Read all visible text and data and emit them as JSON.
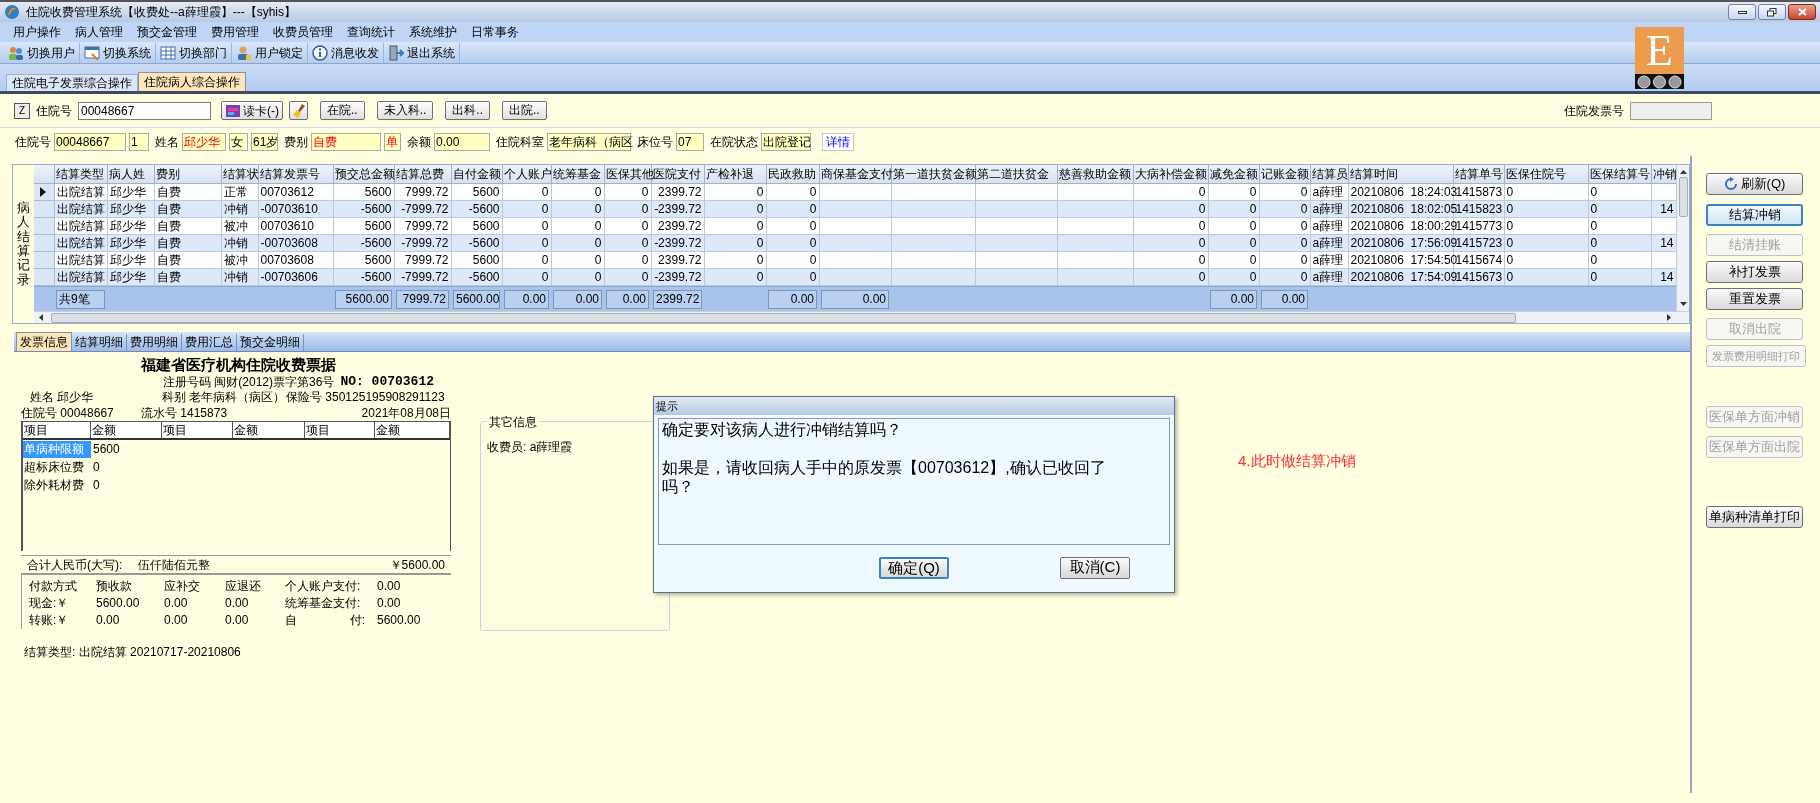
{
  "window": {
    "title": "住院收费管理系统【收费处--a薛理霞】---【syhis】"
  },
  "logo": {
    "letter": "E"
  },
  "menu": [
    "用户操作",
    "病人管理",
    "预交金管理",
    "费用管理",
    "收费员管理",
    "查询统计",
    "系统维护",
    "日常事务"
  ],
  "toolbar": [
    "切换用户",
    "切换系统",
    "切换部门",
    "用户锁定",
    "消息收发",
    "退出系统"
  ],
  "tabs": [
    {
      "label": "住院电子发票综合操作",
      "selected": false
    },
    {
      "label": "住院病人综合操作",
      "selected": true
    }
  ],
  "search": {
    "z_button": "Z",
    "label": "住院号",
    "value": "00048667",
    "read_card": "读卡(-)",
    "filters": [
      "在院..",
      "未入科..",
      "出科..",
      "出院.."
    ],
    "invoice_label": "住院发票号"
  },
  "patient": [
    {
      "kind": "label",
      "text": "住院号"
    },
    {
      "kind": "field",
      "text": "00048667",
      "alert": false
    },
    {
      "kind": "field",
      "text": "1",
      "alert": false
    },
    {
      "kind": "label",
      "text": "姓名"
    },
    {
      "kind": "field",
      "text": "邱少华",
      "alert": true
    },
    {
      "kind": "field",
      "text": "女",
      "alert": false
    },
    {
      "kind": "field",
      "text": "61岁",
      "alert": false
    },
    {
      "kind": "label",
      "text": "费别"
    },
    {
      "kind": "field",
      "text": "自费",
      "alert": true
    },
    {
      "kind": "field",
      "text": "单",
      "alert": true
    },
    {
      "kind": "label",
      "text": "余额"
    },
    {
      "kind": "field",
      "text": "0.00",
      "alert": false
    },
    {
      "kind": "label",
      "text": "住院科室"
    },
    {
      "kind": "field",
      "text": "老年病科（病区",
      "alert": false
    },
    {
      "kind": "label",
      "text": "床位号"
    },
    {
      "kind": "field",
      "text": "07",
      "alert": false
    },
    {
      "kind": "label",
      "text": "在院状态"
    },
    {
      "kind": "field",
      "text": "出院登记",
      "alert": false
    },
    {
      "kind": "link",
      "text": "详情"
    }
  ],
  "table": {
    "side_label": "病人结算记录",
    "columns": [
      "结算类型",
      "病人姓",
      "费别",
      "结算状",
      "结算发票号",
      "预交总金额",
      "结算总费",
      "自付金额",
      "个人账户",
      "统筹基金",
      "医保其他",
      "医院支付",
      "产检补退",
      "民政救助",
      "商保基金支付",
      "第一道扶贫金额",
      "第二道扶贫金",
      "慈善救助金额",
      "大病补偿金额",
      "减免金额",
      "记账金额",
      "结算员",
      "结算时间",
      "结算单号",
      "医保住院号",
      "医保结算号",
      "冲销"
    ],
    "rows": [
      {
        "selected": true,
        "cells": [
          "出院结算",
          "邱少华",
          "自费",
          "正常",
          "00703612",
          "5600",
          "7999.72",
          "5600",
          "0",
          "0",
          "0",
          "2399.72",
          "0",
          "0",
          {
            "kind": "blank"
          },
          {
            "kind": "blank"
          },
          {
            "kind": "blank"
          },
          {
            "kind": "blank"
          },
          "0",
          "0",
          "0",
          "a薛理",
          "20210806  18:24:03",
          "1415873",
          "0",
          "0",
          {
            "kind": "blank"
          }
        ]
      },
      {
        "selected": false,
        "cells": [
          "出院结算",
          "邱少华",
          "自费",
          "冲销",
          "-00703610",
          "-5600",
          "-7999.72",
          "-5600",
          "0",
          "0",
          "0",
          "-2399.72",
          "0",
          "0",
          {
            "kind": "blank"
          },
          {
            "kind": "blank"
          },
          {
            "kind": "blank"
          },
          {
            "kind": "blank"
          },
          "0",
          "0",
          "0",
          "a薛理",
          "20210806  18:02:05",
          "1415823",
          "0",
          "0",
          "14"
        ]
      },
      {
        "selected": false,
        "cells": [
          "出院结算",
          "邱少华",
          "自费",
          "被冲",
          "00703610",
          "5600",
          "7999.72",
          "5600",
          "0",
          "0",
          "0",
          "2399.72",
          "0",
          "0",
          {
            "kind": "blank"
          },
          {
            "kind": "blank"
          },
          {
            "kind": "blank"
          },
          {
            "kind": "blank"
          },
          "0",
          "0",
          "0",
          "a薛理",
          "20210806  18:00:29",
          "1415773",
          "0",
          "0",
          {
            "kind": "blank"
          }
        ]
      },
      {
        "selected": false,
        "cells": [
          "出院结算",
          "邱少华",
          "自费",
          "冲销",
          "-00703608",
          "-5600",
          "-7999.72",
          "-5600",
          "0",
          "0",
          "0",
          "-2399.72",
          "0",
          "0",
          {
            "kind": "blank"
          },
          {
            "kind": "blank"
          },
          {
            "kind": "blank"
          },
          {
            "kind": "blank"
          },
          "0",
          "0",
          "0",
          "a薛理",
          "20210806  17:56:09",
          "1415723",
          "0",
          "0",
          "14"
        ]
      },
      {
        "selected": false,
        "cells": [
          "出院结算",
          "邱少华",
          "自费",
          "被冲",
          "00703608",
          "5600",
          "7999.72",
          "5600",
          "0",
          "0",
          "0",
          "2399.72",
          "0",
          "0",
          {
            "kind": "blank"
          },
          {
            "kind": "blank"
          },
          {
            "kind": "blank"
          },
          {
            "kind": "blank"
          },
          "0",
          "0",
          "0",
          "a薛理",
          "20210806  17:54:50",
          "1415674",
          "0",
          "0",
          {
            "kind": "blank"
          }
        ]
      },
      {
        "selected": false,
        "cells": [
          "出院结算",
          "邱少华",
          "自费",
          "冲销",
          "-00703606",
          "-5600",
          "-7999.72",
          "-5600",
          "0",
          "0",
          "0",
          "-2399.72",
          "0",
          "0",
          {
            "kind": "blank"
          },
          {
            "kind": "blank"
          },
          {
            "kind": "blank"
          },
          {
            "kind": "blank"
          },
          "0",
          "0",
          "0",
          "a薛理",
          "20210806  17:54:09",
          "1415673",
          "0",
          "0",
          "14"
        ]
      }
    ],
    "footer": [
      "共9笔",
      {
        "kind": "blank"
      },
      {
        "kind": "blank"
      },
      {
        "kind": "blank"
      },
      {
        "kind": "blank"
      },
      "5600.00",
      "7999.72",
      "5600.00",
      "0.00",
      "0.00",
      "0.00",
      "2399.72",
      {
        "kind": "blank"
      },
      "0.00",
      "0.00",
      {
        "kind": "blank"
      },
      {
        "kind": "blank"
      },
      {
        "kind": "blank"
      },
      {
        "kind": "blank"
      },
      "0.00",
      "0.00"
    ]
  },
  "right_buttons": [
    {
      "label": "刷新(Q)",
      "kind": "refresh",
      "disabled": false,
      "focused": false
    },
    {
      "label": "结算冲销",
      "kind": "plain",
      "disabled": false,
      "focused": true
    },
    {
      "label": "结清挂账",
      "kind": "plain",
      "disabled": true,
      "focused": false
    },
    {
      "label": "补打发票",
      "kind": "plain",
      "disabled": false,
      "focused": false
    },
    {
      "label": "重置发票",
      "kind": "plain",
      "disabled": false,
      "focused": false
    },
    {
      "label": "取消出院",
      "kind": "plain",
      "disabled": true,
      "focused": false
    },
    {
      "label": "发票费用明细打印",
      "kind": "plain",
      "disabled": true,
      "focused": false
    },
    {
      "label": "医保单方面冲销",
      "kind": "plain",
      "disabled": true,
      "focused": false
    },
    {
      "label": "医保单方面出院",
      "kind": "plain",
      "disabled": true,
      "focused": false
    },
    {
      "label": "单病种清单打印",
      "kind": "plain",
      "disabled": false,
      "focused": false
    }
  ],
  "detail_tabs": [
    {
      "label": "发票信息",
      "selected": true
    },
    {
      "label": "结算明细",
      "selected": false
    },
    {
      "label": "费用明细",
      "selected": false
    },
    {
      "label": "费用汇总",
      "selected": false
    },
    {
      "label": "预交金明细",
      "selected": false
    }
  ],
  "invoice": {
    "title": "福建省医疗机构住院收费票据",
    "reg": "注册号码 闽财(2012)票字第36号",
    "no": "NO: 00703612",
    "name": "姓名 邱少华",
    "dept": "科别 老年病科（病区）",
    "insurance": "保险号 350125195908291123",
    "admission": "住院号 00048667",
    "serial": "流水号 1415873",
    "date": "2021年08月08日",
    "item_headers": [
      "项目",
      "金额",
      "项目",
      "金额",
      "项目",
      "金额"
    ],
    "items": [
      {
        "name": "单病种限额",
        "amount": "5600",
        "selected": true
      },
      {
        "name": "超标床位费",
        "amount": "0",
        "selected": false
      },
      {
        "name": "除外耗材费",
        "amount": "0",
        "selected": false
      }
    ],
    "total_label": "合计人民币(大写):",
    "total_words": "伍仟陆佰元整",
    "total": "￥5600.00",
    "payment": [
      {
        "cells": [
          "付款方式",
          "预收款",
          "应补交",
          "应退还"
        ],
        "label": [
          "个人账户支付:"
        ],
        "value": "0.00"
      },
      {
        "cells": [
          "现金:￥",
          "5600.00",
          "0.00",
          "0.00"
        ],
        "label": [
          "统筹基金支付:"
        ],
        "value": "0.00"
      },
      {
        "cells": [
          "转账:￥",
          "0.00",
          "0.00",
          "0.00"
        ],
        "label": [
          "自",
          "付:"
        ],
        "value": "5600.00"
      }
    ],
    "settle_type": "结算类型: 出院结算 20210717-20210806"
  },
  "other_info": {
    "title": "其它信息",
    "cashier": "收费员: a薛理霞"
  },
  "annotation": "4.此时做结算冲销",
  "dialog": {
    "title": "提示",
    "lines": [
      "确定要对该病人进行冲销结算吗？",
      "如果是，请收回病人手中的原发票【00703612】,确认已收回了吗？"
    ],
    "buttons": [
      {
        "label": "确定(Q)",
        "focused": true
      },
      {
        "label": "取消(C)",
        "focused": false
      }
    ]
  }
}
